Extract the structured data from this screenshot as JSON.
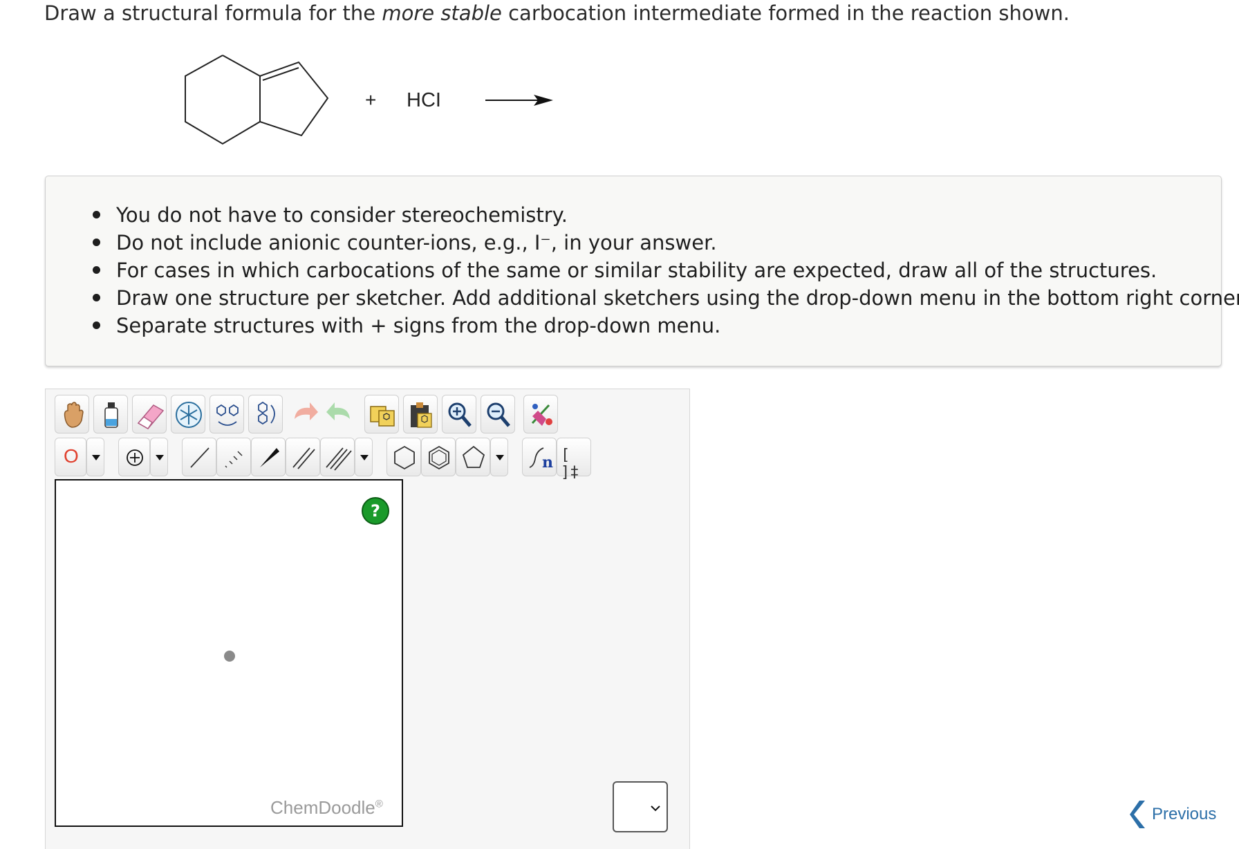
{
  "question": {
    "before": "Draw a structural formula for the ",
    "emphasis": "more  stable",
    "after": " carbocation intermediate formed in the reaction shown."
  },
  "reaction": {
    "plus": "+",
    "reagent": "HCI"
  },
  "instructions": [
    "You do not have to consider stereochemistry.",
    "Do not include anionic counter-ions, e.g., I⁻, in your answer.",
    "For cases in which carbocations of the same or similar stability are expected, draw all of the structures.",
    "Draw one structure per sketcher. Add additional sketchers using the drop-down menu in the bottom right corner.",
    "Separate structures with + signs from the drop-down menu."
  ],
  "toolbar": {
    "atom_label": "O",
    "template_label": "[ ]‡",
    "polymer_label": "n"
  },
  "canvas": {
    "help_label": "?",
    "brand": "ChemDoodle",
    "brand_mark": "®"
  },
  "select": {
    "value": ""
  },
  "nav": {
    "previous_label": "Previous"
  }
}
